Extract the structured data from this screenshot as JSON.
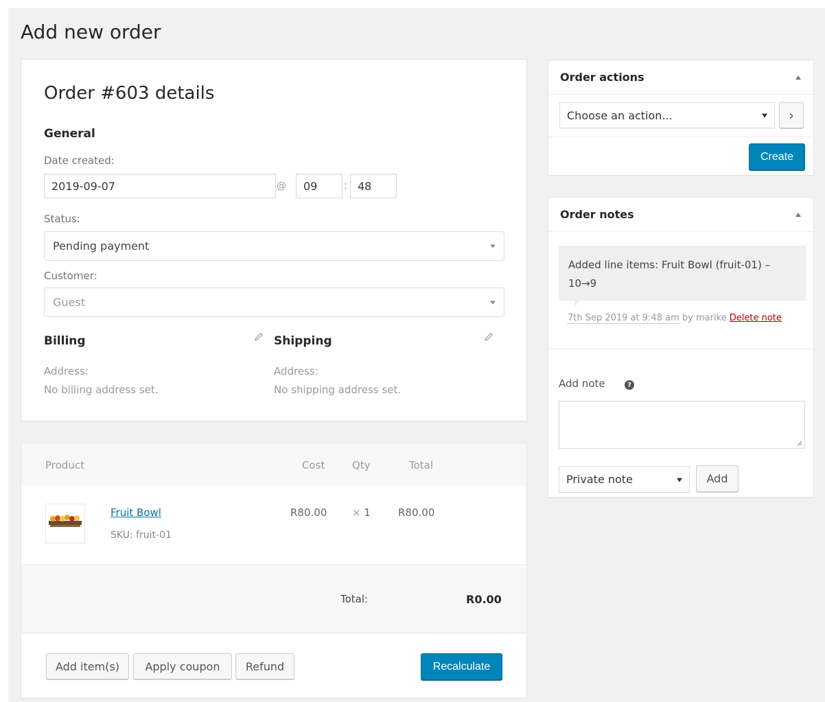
{
  "page": {
    "title": "Add new order"
  },
  "order": {
    "heading": "Order #603 details",
    "general_label": "General",
    "date_created_label": "Date created:",
    "date_value": "2019-09-07",
    "at_symbol": "@",
    "hour_value": "09",
    "colon": ":",
    "minute_value": "48",
    "status_label": "Status:",
    "status_value": "Pending payment",
    "customer_label": "Customer:",
    "customer_value": "Guest",
    "billing": {
      "title": "Billing",
      "address_label": "Address:",
      "address_value": "No billing address set."
    },
    "shipping": {
      "title": "Shipping",
      "address_label": "Address:",
      "address_value": "No shipping address set."
    }
  },
  "items": {
    "headers": {
      "product": "Product",
      "cost": "Cost",
      "qty": "Qty",
      "total": "Total"
    },
    "rows": [
      {
        "name": "Fruit Bowl",
        "sku_label": "SKU:",
        "sku": "fruit-01",
        "cost": "R80.00",
        "qty_prefix": "×",
        "qty": "1",
        "total": "R80.00"
      }
    ],
    "total_label": "Total:",
    "total_value": "R0.00",
    "buttons": {
      "add_items": "Add item(s)",
      "apply_coupon": "Apply coupon",
      "refund": "Refund",
      "recalculate": "Recalculate"
    }
  },
  "order_actions": {
    "title": "Order actions",
    "select_value": "Choose an action...",
    "go_glyph": "›",
    "create_label": "Create"
  },
  "order_notes": {
    "title": "Order notes",
    "note_text": "Added line items: Fruit Bowl (fruit-01) – 10→9",
    "note_date": "7th Sep 2019 at 9:48 am",
    "note_by": "by marike",
    "delete_label": "Delete note",
    "add_note_label": "Add note",
    "help_glyph": "?",
    "note_type_value": "Private note",
    "add_button": "Add"
  }
}
